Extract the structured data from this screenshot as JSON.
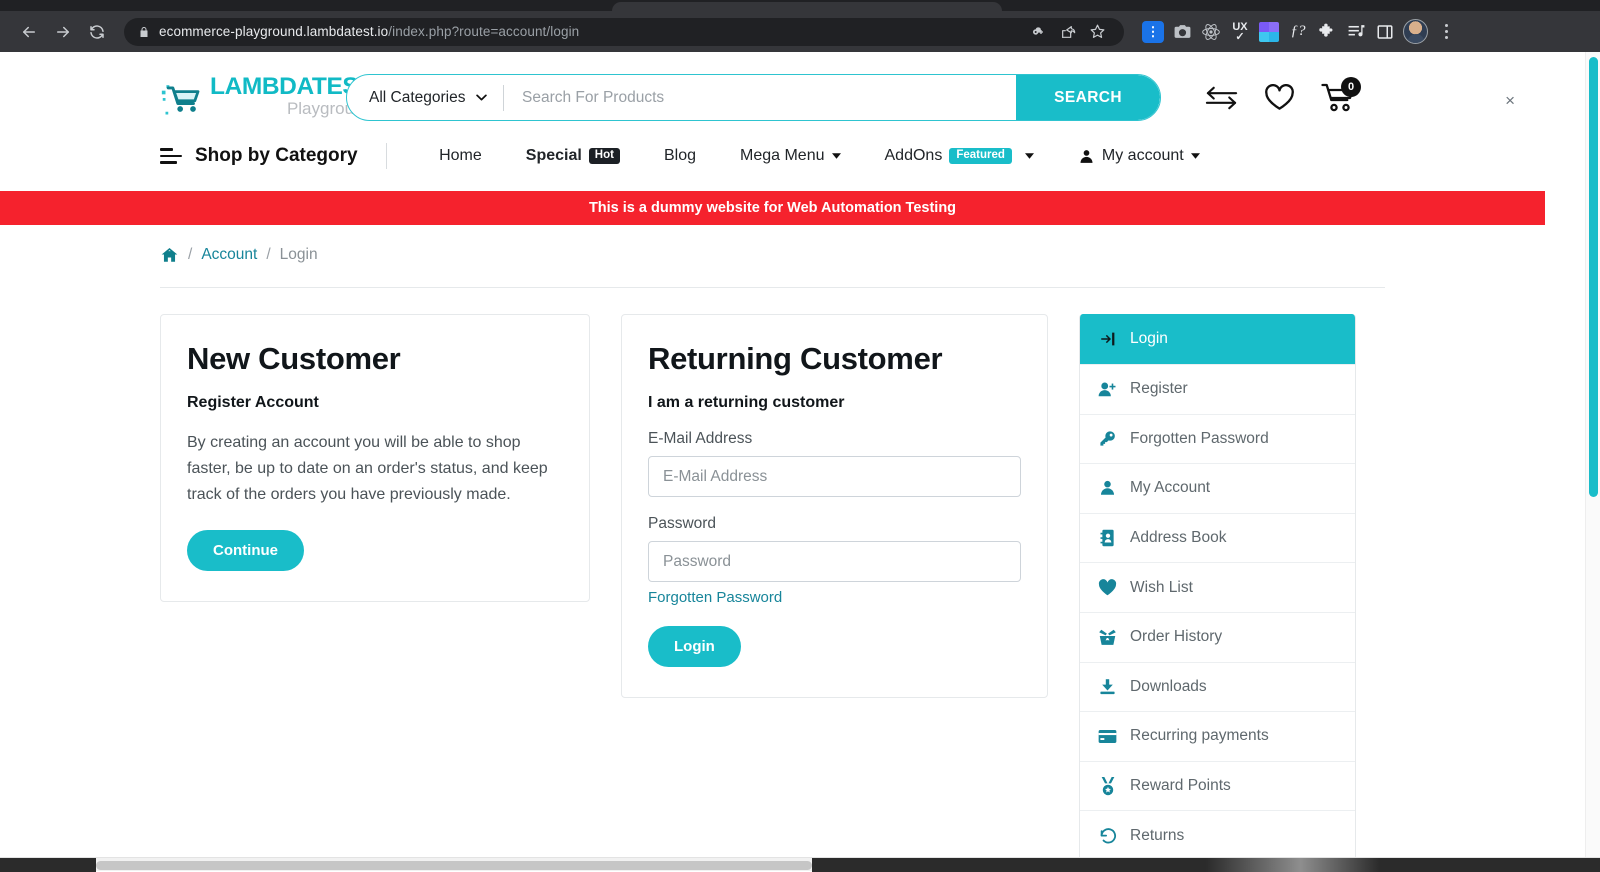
{
  "browser": {
    "url_domain": "ecommerce-playground.lambdatest.io",
    "url_path": "/index.php?route=account/login",
    "back_icon": "back-arrow-icon",
    "forward_icon": "forward-arrow-icon",
    "reload_icon": "reload-icon",
    "lock_icon": "lock-icon",
    "omni_icons": [
      "password-key-icon",
      "share-icon",
      "bookmark-star-icon"
    ],
    "extensions": [
      "blue-extension-icon",
      "camera-icon",
      "react-devtools-icon",
      "ux-check-icon",
      "color-grid-icon",
      "function-question-icon",
      "puzzle-extensions-icon",
      "playlist-icon",
      "side-panel-icon"
    ],
    "profile_icon": "profile-avatar-icon",
    "menu_icon": "three-dot-menu-icon"
  },
  "header": {
    "logo_main": "LAMBDATEST",
    "logo_sub": "Playground",
    "logo_icon": "shopping-cart-logo-icon",
    "search": {
      "category_label": "All Categories",
      "placeholder": "Search For Products",
      "value": "",
      "button_label": "SEARCH"
    },
    "icons": {
      "compare": "compare-arrows-icon",
      "wishlist": "heart-icon",
      "cart": "shopping-cart-icon",
      "cart_count": "0"
    }
  },
  "nav": {
    "shop_by_category": "Shop by Category",
    "burger_icon": "menu-lines-icon",
    "links": [
      {
        "label": "Home",
        "badge": "",
        "badge_type": "",
        "caret": false
      },
      {
        "label": "Special",
        "badge": "Hot",
        "badge_type": "hot",
        "caret": false
      },
      {
        "label": "Blog",
        "badge": "",
        "badge_type": "",
        "caret": false
      },
      {
        "label": "Mega Menu",
        "badge": "",
        "badge_type": "",
        "caret": true
      },
      {
        "label": "AddOns",
        "badge": "Featured",
        "badge_type": "featured",
        "caret": true
      },
      {
        "label": "My account",
        "badge": "",
        "badge_type": "",
        "caret": true,
        "icon": "user-icon"
      }
    ]
  },
  "alert": {
    "text": "This is a dummy website for Web Automation Testing",
    "color": "#f5222d"
  },
  "breadcrumb": {
    "home_icon": "home-icon",
    "sep": "/",
    "account": "Account",
    "current": "Login"
  },
  "close_button": "×",
  "new_customer": {
    "title": "New Customer",
    "subtitle": "Register Account",
    "body": "By creating an account you will be able to shop faster, be up to date on an order's status, and keep track of the orders you have previously made.",
    "button_label": "Continue"
  },
  "returning_customer": {
    "title": "Returning Customer",
    "subtitle": "I am a returning customer",
    "email_label": "E-Mail Address",
    "email_placeholder": "E-Mail Address",
    "email_value": "",
    "password_label": "Password",
    "password_placeholder": "Password",
    "password_value": "",
    "forgot_link": "Forgotten Password",
    "button_label": "Login"
  },
  "aside": {
    "items": [
      {
        "label": "Login",
        "icon": "sign-in-icon",
        "active": true
      },
      {
        "label": "Register",
        "icon": "user-plus-icon",
        "active": false
      },
      {
        "label": "Forgotten Password",
        "icon": "key-icon",
        "active": false
      },
      {
        "label": "My Account",
        "icon": "user-icon",
        "active": false
      },
      {
        "label": "Address Book",
        "icon": "address-book-icon",
        "active": false
      },
      {
        "label": "Wish List",
        "icon": "heart-icon",
        "active": false
      },
      {
        "label": "Order History",
        "icon": "open-box-icon",
        "active": false
      },
      {
        "label": "Downloads",
        "icon": "download-icon",
        "active": false
      },
      {
        "label": "Recurring payments",
        "icon": "credit-card-icon",
        "active": false
      },
      {
        "label": "Reward Points",
        "icon": "medal-icon",
        "active": false
      },
      {
        "label": "Returns",
        "icon": "undo-arrow-icon",
        "active": false
      }
    ]
  },
  "colors": {
    "accent": "#19bdc9",
    "link": "#17859a",
    "alert": "#f5222d",
    "badge_hot": "#1c2025"
  }
}
